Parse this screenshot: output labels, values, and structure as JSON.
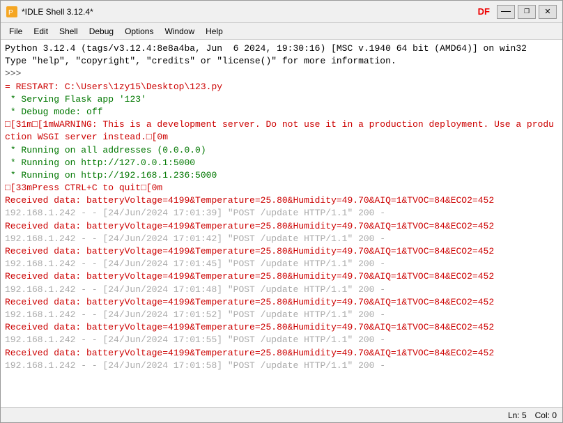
{
  "window": {
    "title": "*IDLE Shell 3.12.4*",
    "minimize_btn": "—",
    "maximize_btn": "❐",
    "close_btn": "✕",
    "df_badge": "DF"
  },
  "menu": {
    "items": [
      "File",
      "Edit",
      "Shell",
      "Debug",
      "Options",
      "Window",
      "Help"
    ]
  },
  "content": {
    "lines": [
      {
        "text": "Python 3.12.4 (tags/v3.12.4:8e8a4ba, Jun  6 2024, 19:30:16) [MSC v.1940 64 bit (AMD64)] on win32",
        "class": ""
      },
      {
        "text": "Type \"help\", \"copyright\", \"credits\" or \"license()\" for more information.",
        "class": ""
      },
      {
        "text": ">>> ",
        "class": "prompt"
      },
      {
        "text": "= RESTART: C:\\Users\\1zy15\\Desktop\\123.py",
        "class": "restart-line"
      },
      {
        "text": " * Serving Flask app '123'",
        "class": "flask-line"
      },
      {
        "text": " * Debug mode: off",
        "class": "flask-line"
      },
      {
        "text": "□[31m□[1mWARNING: This is a development server. Do not use it in a production deployment. Use a production WSGI server instead.□[0m",
        "class": "warning-line"
      },
      {
        "text": " * Running on all addresses (0.0.0.0)",
        "class": "running-line"
      },
      {
        "text": " * Running on http://127.0.0.1:5000",
        "class": "running-line"
      },
      {
        "text": " * Running on http://192.168.1.236:5000",
        "class": "running-line"
      },
      {
        "text": "□[33mPress CTRL+C to quit□[0m",
        "class": "warning-line"
      },
      {
        "text": "Received data: batteryVoltage=4199&Temperature=25.80&Humidity=49.70&AIQ=1&TVOC=84&ECO2=452",
        "class": "received-line"
      },
      {
        "text": "192.168.1.242 - - [24/Jun/2024 17:01:39] \"POST /update HTTP/1.1\" 200 -",
        "class": "http-line"
      },
      {
        "text": "Received data: batteryVoltage=4199&Temperature=25.80&Humidity=49.70&AIQ=1&TVOC=84&ECO2=452",
        "class": "received-line"
      },
      {
        "text": "192.168.1.242 - - [24/Jun/2024 17:01:42] \"POST /update HTTP/1.1\" 200 -",
        "class": "http-line"
      },
      {
        "text": "Received data: batteryVoltage=4199&Temperature=25.80&Humidity=49.70&AIQ=1&TVOC=84&ECO2=452",
        "class": "received-line"
      },
      {
        "text": "192.168.1.242 - - [24/Jun/2024 17:01:45] \"POST /update HTTP/1.1\" 200 -",
        "class": "http-line"
      },
      {
        "text": "Received data: batteryVoltage=4199&Temperature=25.80&Humidity=49.70&AIQ=1&TVOC=84&ECO2=452",
        "class": "received-line"
      },
      {
        "text": "192.168.1.242 - - [24/Jun/2024 17:01:48] \"POST /update HTTP/1.1\" 200 -",
        "class": "http-line"
      },
      {
        "text": "Received data: batteryVoltage=4199&Temperature=25.80&Humidity=49.70&AIQ=1&TVOC=84&ECO2=452",
        "class": "received-line"
      },
      {
        "text": "192.168.1.242 - - [24/Jun/2024 17:01:52] \"POST /update HTTP/1.1\" 200 -",
        "class": "http-line"
      },
      {
        "text": "Received data: batteryVoltage=4199&Temperature=25.80&Humidity=49.70&AIQ=1&TVOC=84&ECO2=452",
        "class": "received-line"
      },
      {
        "text": "192.168.1.242 - - [24/Jun/2024 17:01:55] \"POST /update HTTP/1.1\" 200 -",
        "class": "http-line"
      },
      {
        "text": "Received data: batteryVoltage=4199&Temperature=25.80&Humidity=49.70&AIQ=1&TVOC=84&ECO2=452",
        "class": "received-line"
      },
      {
        "text": "192.168.1.242 - - [24/Jun/2024 17:01:58] \"POST /update HTTP/1.1\" 200 -",
        "class": "http-line"
      }
    ]
  },
  "status_bar": {
    "ln": "Ln: 5",
    "col": "Col: 0"
  }
}
